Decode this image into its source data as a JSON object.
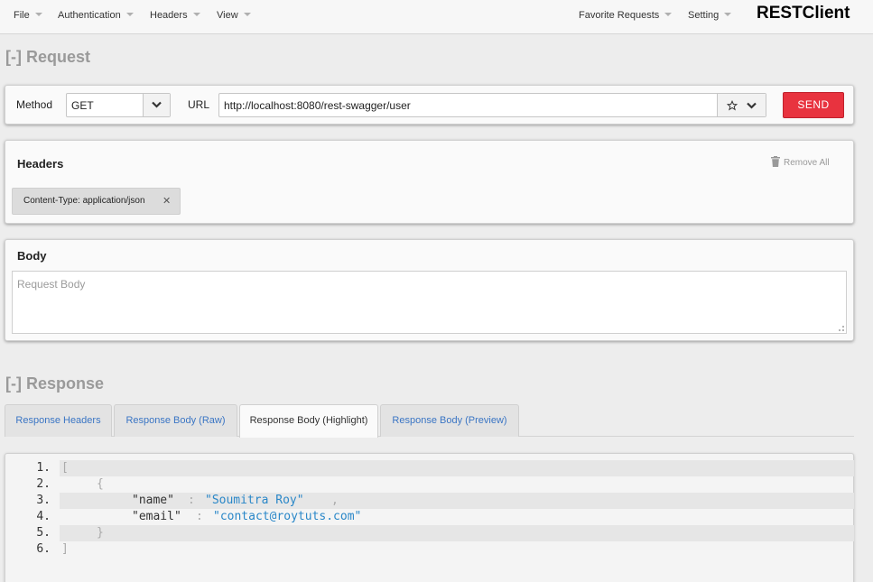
{
  "menu": {
    "file": "File",
    "authentication": "Authentication",
    "headers": "Headers",
    "view": "View",
    "favorite_requests": "Favorite Requests",
    "setting": "Setting",
    "brand": "RESTClient"
  },
  "request": {
    "section_title": "[-] Request",
    "method_label": "Method",
    "method_value": "GET",
    "url_label": "URL",
    "url_value": "http://localhost:8080/rest-swagger/user",
    "send_label": "SEND"
  },
  "headers": {
    "title": "Headers",
    "remove_all": "Remove All",
    "items": [
      "Content-Type: application/json"
    ]
  },
  "body": {
    "title": "Body",
    "placeholder": "Request Body"
  },
  "response": {
    "section_title": "[-] Response",
    "tabs": [
      "Response Headers",
      "Response Body (Raw)",
      "Response Body (Highlight)",
      "Response Body (Preview)"
    ],
    "active_tab": 2,
    "code": {
      "line_numbers": [
        "1.",
        "2.",
        "3.",
        "4.",
        "5.",
        "6."
      ],
      "open_bracket": "[",
      "open_brace": "{",
      "key_name": "\"name\"",
      "colon": ":",
      "value_name": "\"Soumitra Roy\"",
      "comma": ",",
      "key_email": "\"email\"",
      "value_email": "\"contact@roytuts.com\"",
      "close_brace": "}",
      "close_bracket": "]"
    }
  },
  "colors": {
    "send": "#e8333f",
    "tab_link": "#3a75c4",
    "json_string": "#2a87c8"
  }
}
